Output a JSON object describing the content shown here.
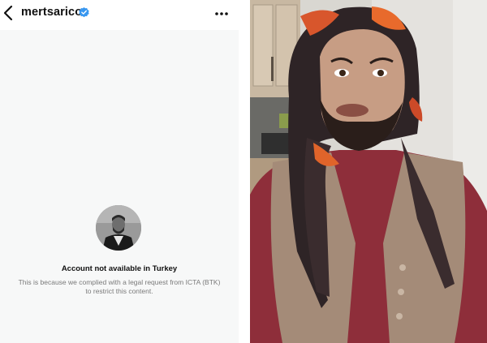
{
  "header": {
    "username": "mertsarico",
    "back_icon": "chevron-left-icon",
    "verified_icon": "verified-badge-icon",
    "more_icon": "more-horizontal-icon"
  },
  "restriction_notice": {
    "title": "Account not available in Turkey",
    "body": "This is because we complied with a legal request from ICTA (BTK) to restrict this content."
  },
  "colors": {
    "verified_blue": "#3897f0",
    "panel_background": "#f7f8f8",
    "muted_text": "#7a7a7a"
  }
}
